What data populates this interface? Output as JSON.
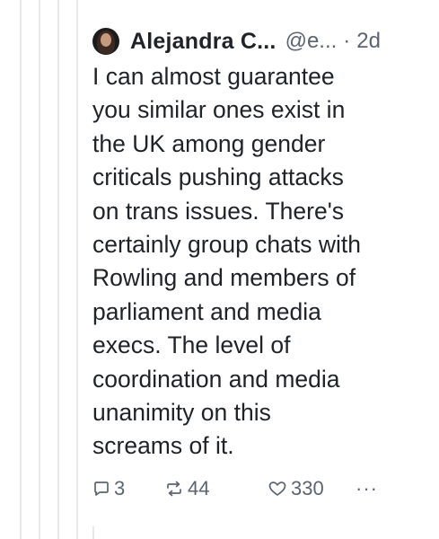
{
  "post": {
    "author_name": "Alejandra C...",
    "author_handle": "@e...",
    "separator": "·",
    "age": "2d",
    "text": "I can almost guarantee\nyou similar ones exist in\nthe UK among gender\ncriticals pushing attacks\non trans issues. There's\ncertainly group chats with\nRowling and members of\nparliament and media\nexecs. The level of\ncoordination and media\nunanimity on this\nscreams of it.",
    "reply_count": "3",
    "repost_count": "44",
    "like_count": "330",
    "more_label": "···"
  },
  "icons": {
    "reply": "reply-bubble-icon",
    "repost": "repost-arrows-icon",
    "like": "heart-icon",
    "more": "more-dots-icon"
  },
  "colors": {
    "text": "#1f2328",
    "muted": "#5b6470",
    "thread_line": "#e6e8ec"
  }
}
